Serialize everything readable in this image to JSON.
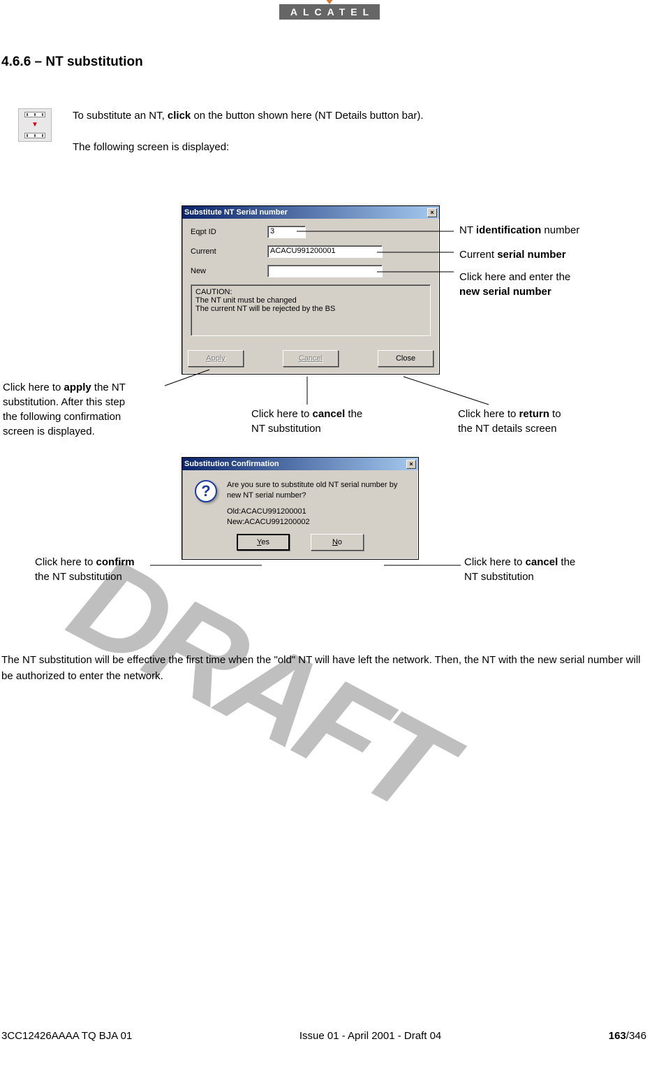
{
  "logo_text": "ALCATEL",
  "section_heading": "4.6.6 –  NT substitution",
  "intro": {
    "line1_pre": "To substitute an NT, ",
    "line1_bold": "click",
    "line1_post": " on the button shown here (NT Details button bar).",
    "line2": "The following screen is displayed:"
  },
  "dialog1": {
    "title": "Substitute NT Serial number",
    "fields": {
      "eqpt_label": "Eqpt ID",
      "eqpt_value": "3",
      "current_label": "Current",
      "current_value": "ACACU991200001",
      "new_label": "New",
      "new_value": ""
    },
    "caution": {
      "l1": "CAUTION:",
      "l2": "The NT unit must be changed",
      "l3": "The current NT will be rejected by the BS"
    },
    "buttons": {
      "apply": "Apply",
      "cancel": "Cancel",
      "close": "Close"
    }
  },
  "dialog2": {
    "title": "Substitution Confirmation",
    "msg_l1": "Are you sure to substitute old NT serial number by",
    "msg_l2": "new NT serial number?",
    "old": "Old:ACACU991200001",
    "new": "New:ACACU991200002",
    "yes": "Yes",
    "no": "No",
    "q": "?"
  },
  "callouts": {
    "nt_id_pre": "NT ",
    "nt_id_bold": "identification",
    "nt_id_post": " number",
    "current_pre": "Current ",
    "current_bold": "serial number",
    "new_l1": "Click here and enter the",
    "new_bold": "new serial number",
    "apply": {
      "l1_pre": "Click here to ",
      "l1_bold": "apply",
      "l1_post": " the NT",
      "l2": "substitution. After this step",
      "l3": "the following confirmation",
      "l4": "screen is displayed."
    },
    "cancel1_pre": "Click here to ",
    "cancel1_bold": "cancel",
    "cancel1_post": " the",
    "cancel1_l2": "NT substitution",
    "return_pre": "Click here to ",
    "return_bold": "return",
    "return_post": " to",
    "return_l2": " the NT details screen",
    "confirm_pre": "Click here to ",
    "confirm_bold": "confirm",
    "confirm_l2": "the NT substitution",
    "cancel2_pre": "Click here to ",
    "cancel2_bold": "cancel",
    "cancel2_post": " the",
    "cancel2_l2": "NT substitution"
  },
  "body_para": "The NT substitution will be effective the first time when the \"old\" NT will have left the network. Then, the NT with the new serial number will be authorized to enter the network.",
  "footer": {
    "left": "3CC12426AAAA TQ BJA 01",
    "center": "Issue 01 - April 2001 - Draft 04",
    "page_bold": "163",
    "page_rest": "/346"
  },
  "watermark": "DRAFT"
}
